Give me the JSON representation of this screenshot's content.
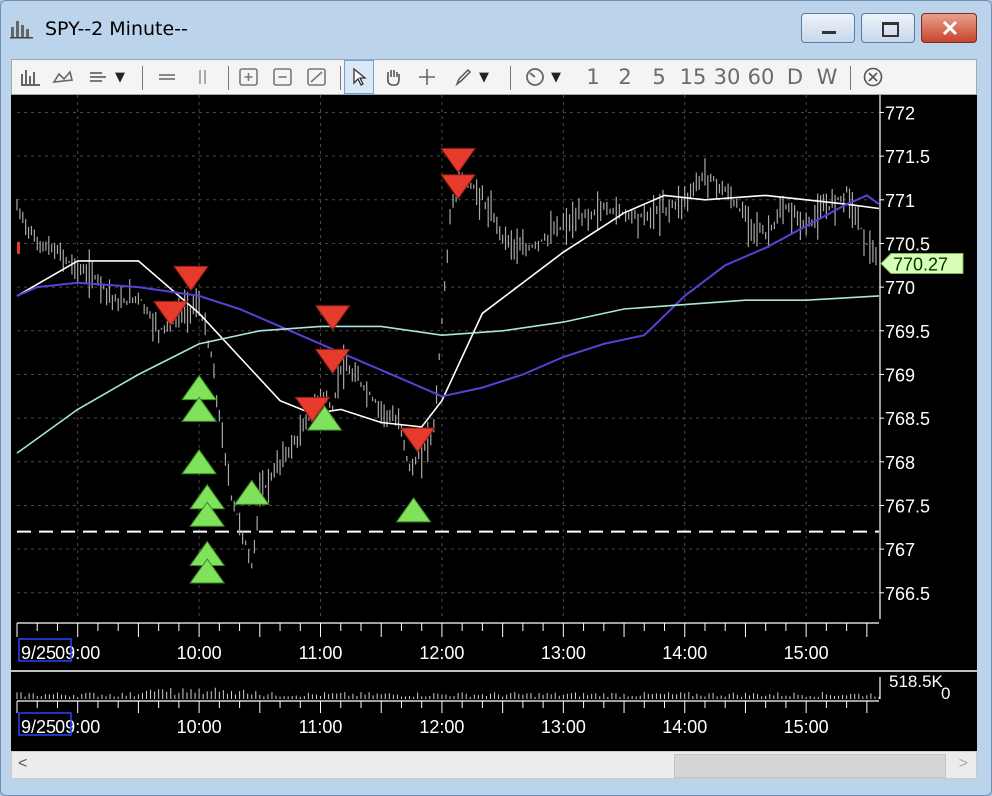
{
  "window": {
    "title": "SPY--2 Minute--",
    "controls": [
      "minimize",
      "maximize",
      "close"
    ]
  },
  "toolbar": {
    "timeframes": [
      "1",
      "2",
      "5",
      "15",
      "30",
      "60",
      "D",
      "W"
    ],
    "tools": [
      "bar-chart-icon",
      "line-chart-icon",
      "study-list-icon",
      "dropdown-icon",
      "horizontal-line-icon",
      "vertical-line-icon",
      "zoom-in-icon",
      "zoom-out-icon",
      "zoom-reset-icon",
      "select-cursor-icon",
      "pan-hand-icon",
      "crosshair-icon",
      "pen-icon",
      "dropdown-icon",
      "clock-icon",
      "dropdown-icon",
      "close-circle-icon"
    ]
  },
  "colors": {
    "background": "#000000",
    "price": "#a8a8a8",
    "ma_fast": "#ffffff",
    "ma_mid": "#5b3fd6",
    "ma_slow": "#a8e6da",
    "sell_signal": "#e53a2c",
    "buy_signal": "#7fe25a",
    "last_price_tag": "#d8ffb8"
  },
  "chart_data": [
    {
      "type": "line",
      "symbol": "SPY",
      "title": "SPY--2 Minute--",
      "date_label": "9/25",
      "x_ticks": [
        "09:00",
        "10:00",
        "11:00",
        "12:00",
        "13:00",
        "14:00",
        "15:00"
      ],
      "x_range": [
        "08:30",
        "15:36"
      ],
      "y_ticks": [
        "772",
        "771.5",
        "771",
        "770.5",
        "770",
        "769.5",
        "769",
        "768.5",
        "768",
        "767.5",
        "767",
        "766.5"
      ],
      "ylim": [
        766.2,
        772.2
      ],
      "grid": true,
      "last_price": "770.27",
      "reference_line": 767.2,
      "series": [
        {
          "role": "price",
          "x": [
            "08:30",
            "08:40",
            "08:50",
            "09:00",
            "09:10",
            "09:20",
            "09:30",
            "09:40",
            "09:50",
            "10:00",
            "10:06",
            "10:10",
            "10:16",
            "10:20",
            "10:26",
            "10:30",
            "10:40",
            "10:50",
            "11:00",
            "11:06",
            "11:10",
            "11:20",
            "11:30",
            "11:40",
            "11:44",
            "11:50",
            "11:56",
            "12:00",
            "12:04",
            "12:10",
            "12:20",
            "12:30",
            "12:40",
            "13:00",
            "13:20",
            "13:40",
            "14:00",
            "14:10",
            "14:20",
            "14:30",
            "14:40",
            "14:50",
            "15:00",
            "15:10",
            "15:20",
            "15:30",
            "15:36"
          ],
          "values": [
            770.9,
            770.5,
            770.4,
            770.2,
            770.1,
            769.8,
            769.9,
            769.5,
            769.7,
            769.8,
            769.2,
            768.5,
            767.6,
            767.3,
            766.8,
            767.6,
            768.0,
            768.3,
            768.8,
            768.6,
            769.1,
            768.9,
            768.6,
            768.4,
            767.9,
            768.1,
            768.4,
            769.6,
            770.8,
            771.3,
            771.0,
            770.6,
            770.4,
            770.7,
            770.9,
            770.8,
            771.0,
            771.3,
            771.1,
            770.8,
            770.6,
            770.9,
            770.7,
            770.9,
            771.1,
            770.5,
            770.3
          ]
        },
        {
          "role": "ma-fast",
          "x": [
            "08:30",
            "09:00",
            "09:30",
            "09:50",
            "10:00",
            "10:20",
            "10:40",
            "10:56",
            "11:10",
            "11:30",
            "11:50",
            "12:00",
            "12:20",
            "13:00",
            "13:30",
            "13:50",
            "14:10",
            "14:40",
            "15:00",
            "15:20",
            "15:36"
          ],
          "values": [
            769.9,
            770.3,
            770.3,
            769.9,
            769.7,
            769.2,
            768.7,
            768.55,
            768.6,
            768.45,
            768.4,
            768.7,
            769.7,
            770.4,
            770.85,
            771.05,
            771.0,
            771.05,
            771.0,
            770.95,
            770.9
          ]
        },
        {
          "role": "ma-mid",
          "x": [
            "08:30",
            "08:40",
            "09:00",
            "09:30",
            "10:00",
            "10:20",
            "10:40",
            "11:00",
            "11:20",
            "11:40",
            "12:00",
            "12:20",
            "12:40",
            "13:00",
            "13:20",
            "13:40",
            "14:00",
            "14:20",
            "14:40",
            "15:00",
            "15:20",
            "15:30",
            "15:36"
          ],
          "values": [
            769.9,
            770.0,
            770.05,
            770.0,
            769.9,
            769.75,
            769.55,
            769.35,
            769.15,
            768.95,
            768.75,
            768.85,
            769.0,
            769.2,
            769.35,
            769.45,
            769.9,
            770.25,
            770.45,
            770.7,
            770.95,
            771.05,
            770.95
          ]
        },
        {
          "role": "ma-slow",
          "x": [
            "08:30",
            "09:00",
            "09:30",
            "10:00",
            "10:30",
            "11:00",
            "11:30",
            "12:00",
            "12:30",
            "13:00",
            "13:30",
            "14:00",
            "14:30",
            "15:00",
            "15:36"
          ],
          "values": [
            768.1,
            768.6,
            769.0,
            769.35,
            769.5,
            769.55,
            769.55,
            769.45,
            769.5,
            769.6,
            769.75,
            769.8,
            769.85,
            769.85,
            769.9
          ]
        }
      ],
      "signals": {
        "sell": [
          {
            "x": "09:56",
            "y": 770.1
          },
          {
            "x": "09:46",
            "y": 769.7
          },
          {
            "x": "11:06",
            "y": 769.65
          },
          {
            "x": "11:06",
            "y": 769.15
          },
          {
            "x": "10:56",
            "y": 768.6
          },
          {
            "x": "11:48",
            "y": 768.25
          },
          {
            "x": "12:08",
            "y": 771.45
          },
          {
            "x": "12:08",
            "y": 771.15
          }
        ],
        "buy": [
          {
            "x": "10:00",
            "y": 768.85
          },
          {
            "x": "10:00",
            "y": 768.6
          },
          {
            "x": "10:00",
            "y": 768.0
          },
          {
            "x": "10:04",
            "y": 767.6
          },
          {
            "x": "10:04",
            "y": 767.4
          },
          {
            "x": "10:04",
            "y": 766.95
          },
          {
            "x": "10:04",
            "y": 766.75
          },
          {
            "x": "10:26",
            "y": 767.65
          },
          {
            "x": "11:02",
            "y": 768.5
          },
          {
            "x": "11:46",
            "y": 767.45
          }
        ]
      }
    },
    {
      "type": "bar",
      "role": "volume",
      "date_label": "9/25",
      "x_ticks": [
        "09:00",
        "10:00",
        "11:00",
        "12:00",
        "13:00",
        "14:00",
        "15:00"
      ],
      "y_ticks": [
        "518.5K",
        "0"
      ],
      "ylim": [
        0,
        518500
      ]
    }
  ]
}
